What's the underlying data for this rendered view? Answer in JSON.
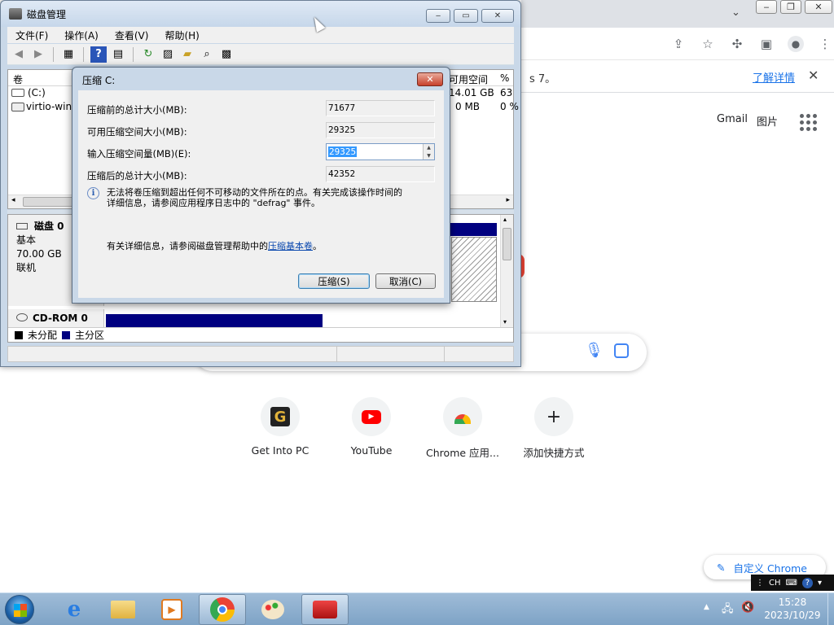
{
  "chrome": {
    "toolbar_icons": [
      "share-icon",
      "star-icon",
      "extensions-icon",
      "sidebar-icon",
      "profile-icon",
      "more-icon"
    ],
    "infobar_text": "s 7。",
    "infobar_link": "了解详情",
    "infobar_close": "✕",
    "header_links": {
      "gmail": "Gmail",
      "images": "图片"
    },
    "shortcuts": [
      {
        "label": "Get Into PC",
        "icon": "G"
      },
      {
        "label": "YouTube",
        "icon": "youtube-icon"
      },
      {
        "label": "Chrome 应用...",
        "icon": "chrome-webstore-icon"
      },
      {
        "label": "添加快捷方式",
        "icon": "+"
      }
    ],
    "customize_label": "自定义 Chrome"
  },
  "diskmgmt": {
    "title": "磁盘管理",
    "menu": [
      "文件(F)",
      "操作(A)",
      "查看(V)",
      "帮助(H)"
    ],
    "list_headers": {
      "volume": "卷",
      "free": "可用空间",
      "pct": "%"
    },
    "volumes": [
      {
        "name": "(C:)",
        "free": "14.01 GB",
        "pct": "63"
      },
      {
        "name": "virtio-win-",
        "free": "0 MB",
        "pct": "0 %"
      }
    ],
    "disk0": {
      "name": "磁盘 0",
      "type": "基本",
      "size": "70.00 GB",
      "status": "联机"
    },
    "cdrom": {
      "name": "CD-ROM 0"
    },
    "legend": {
      "unallocated": "未分配",
      "primary": "主分区"
    },
    "colors": {
      "primary": "#000080",
      "unallocated": "#000000"
    }
  },
  "dialog": {
    "title": "压缩 C:",
    "fields": [
      {
        "label": "压缩前的总计大小(MB):",
        "value": "71677"
      },
      {
        "label": "可用压缩空间大小(MB):",
        "value": "29325"
      },
      {
        "label": "输入压缩空间量(MB)(E):",
        "value": "29325"
      },
      {
        "label": "压缩后的总计大小(MB):",
        "value": "42352"
      }
    ],
    "info_text_1": "无法将卷压缩到超出任何不可移动的文件所在的点。有关完成该操作时间的",
    "info_text_2": "详细信息，请参阅应用程序日志中的 \"defrag\" 事件。",
    "help_prefix": "有关详细信息，请参阅磁盘管理帮助中的",
    "help_link": "压缩基本卷",
    "help_suffix": "。",
    "shrink_button": "压缩(S)",
    "cancel_button": "取消(C)"
  },
  "taskbar": {
    "ime": "CH",
    "time": "15:28",
    "date": "2023/10/29",
    "apps": [
      "ie-icon",
      "explorer-icon",
      "media-player-icon",
      "chrome-icon",
      "paint-icon",
      "toolbox-icon"
    ]
  }
}
